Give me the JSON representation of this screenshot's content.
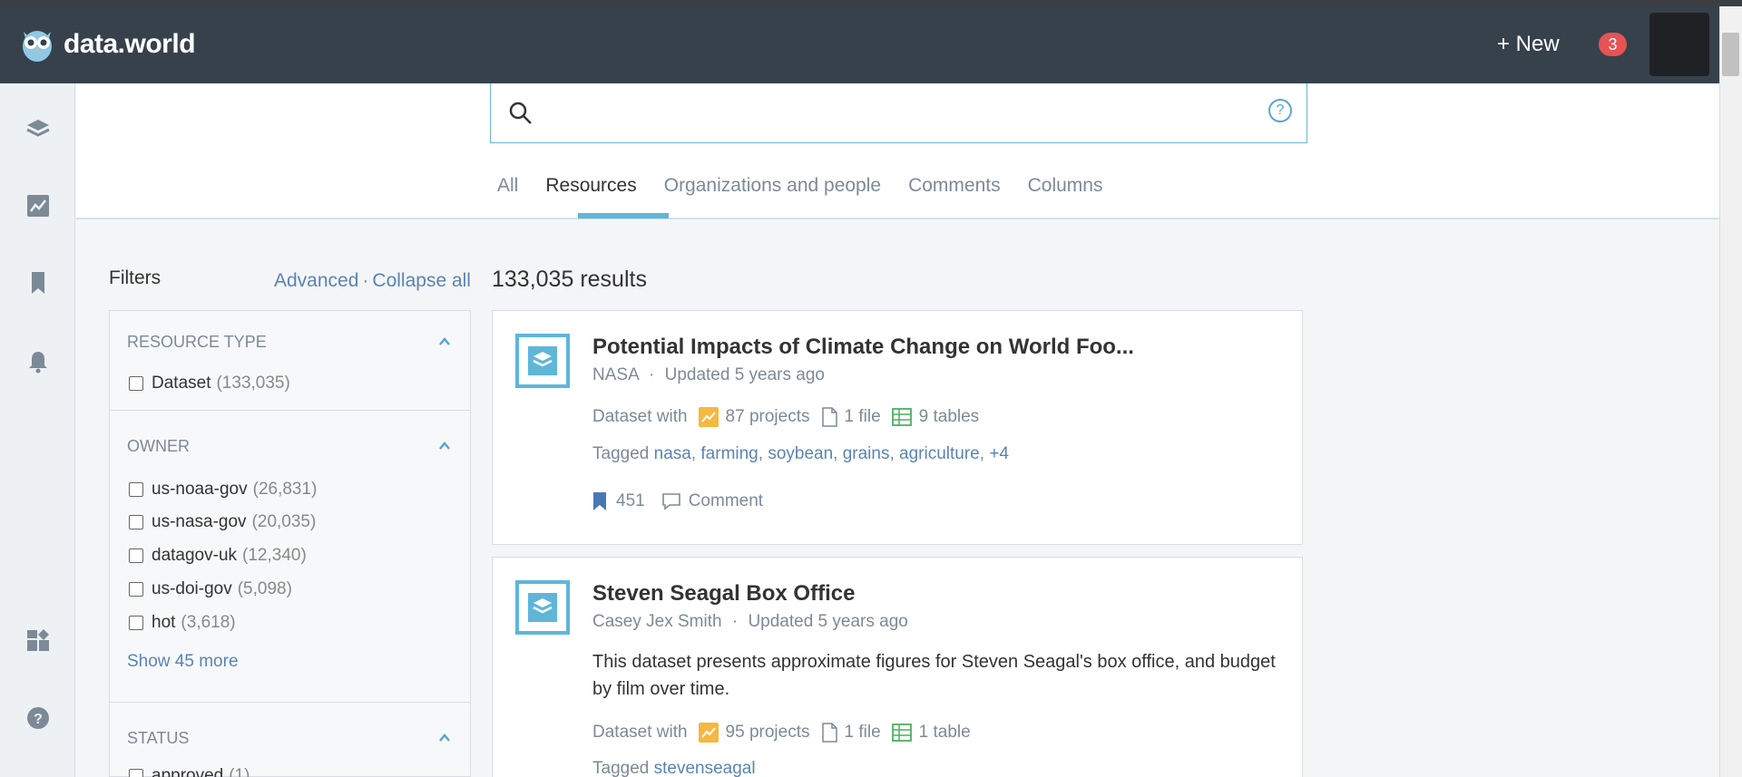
{
  "header": {
    "brand": "data.world",
    "new_label": "+ New",
    "notification_count": "3"
  },
  "rail": {
    "items": [
      "datasets-icon",
      "projects-icon",
      "bookmarks-icon",
      "notifications-icon",
      "dashboard-icon",
      "help-icon"
    ]
  },
  "search": {
    "value": "",
    "help_glyph": "?"
  },
  "tabs": [
    "All",
    "Resources",
    "Organizations and people",
    "Comments",
    "Columns"
  ],
  "active_tab": "Resources",
  "filters": {
    "title": "Filters",
    "advanced": "Advanced",
    "separator": "·",
    "collapse_all": "Collapse all",
    "sections": [
      {
        "heading": "RESOURCE TYPE",
        "options": [
          {
            "label": "Dataset",
            "count": "(133,035)"
          }
        ]
      },
      {
        "heading": "OWNER",
        "options": [
          {
            "label": "us-noaa-gov",
            "count": "(26,831)"
          },
          {
            "label": "us-nasa-gov",
            "count": "(20,035)"
          },
          {
            "label": "datagov-uk",
            "count": "(12,340)"
          },
          {
            "label": "us-doi-gov",
            "count": "(5,098)"
          },
          {
            "label": "hot",
            "count": "(3,618)"
          }
        ],
        "show_more": "Show 45 more"
      },
      {
        "heading": "STATUS",
        "options": [
          {
            "label": "approved",
            "count": "(1)"
          }
        ]
      }
    ]
  },
  "results": {
    "count_label": "133,035 results",
    "items": [
      {
        "title": "Potential Impacts of Climate Change on World Foo...",
        "owner": "NASA",
        "dot": "·",
        "updated": "Updated 5 years ago",
        "dataset_with": "Dataset with",
        "projects": "87 projects",
        "files": "1 file",
        "tables": "9 tables",
        "tagged": "Tagged",
        "tags": [
          "nasa",
          "farming",
          "soybean",
          "grains",
          "agriculture",
          "+4"
        ],
        "bookmarks": "451",
        "comment": "Comment"
      },
      {
        "title": "Steven Seagal Box Office",
        "owner": "Casey Jex Smith",
        "dot": "·",
        "updated": "Updated 5 years ago",
        "description": "This dataset presents approximate figures for Steven Seagal's box office, and budget by film over time.",
        "dataset_with": "Dataset with",
        "projects": "95 projects",
        "files": "1 file",
        "tables": "1 table",
        "tagged": "Tagged",
        "tags": [
          "stevenseagal"
        ]
      }
    ]
  },
  "colors": {
    "header_bg": "#36414b",
    "accent": "#5fb6d9",
    "link": "#5a84b3",
    "badge": "#e55353"
  }
}
